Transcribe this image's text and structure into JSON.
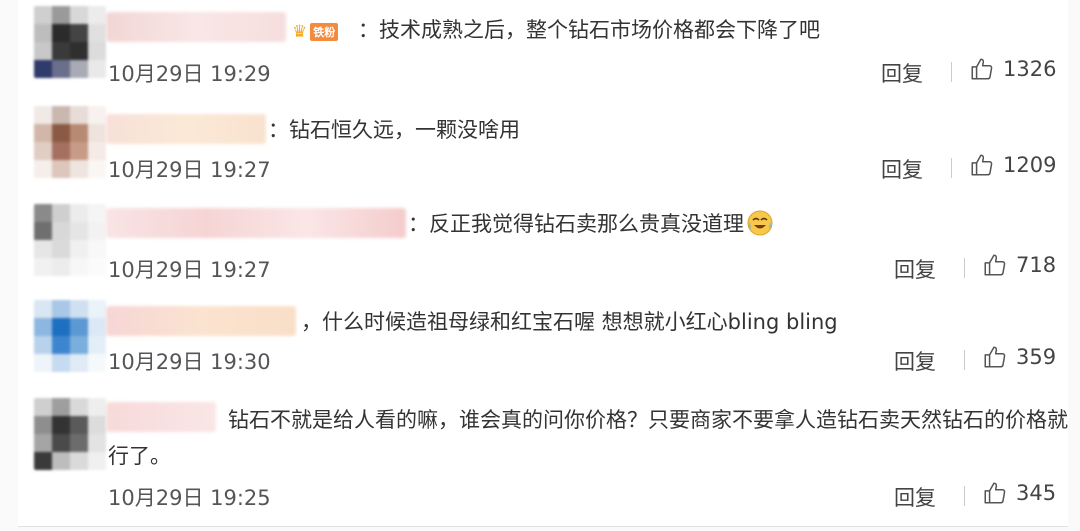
{
  "comments": [
    {
      "text": "：技术成熟之后，整个钻石市场价格都会下降了吧",
      "badge": {
        "tag": "铁粉"
      },
      "time": "10月29日 19:29",
      "reply_label": "回复",
      "likes": "1326"
    },
    {
      "text": "：钻石恒久远，一颗没啥用",
      "time": "10月29日 19:27",
      "reply_label": "回复",
      "likes": "1209"
    },
    {
      "text": "：反正我觉得钻石卖那么贵真没道理",
      "time": "10月29日 19:27",
      "reply_label": "回复",
      "likes": "718"
    },
    {
      "text": "，什么时候造祖母绿和红宝石喔 想想就小红心bling bling",
      "time": "10月29日 19:30",
      "reply_label": "回复",
      "likes": "359"
    },
    {
      "text": "钻石不就是给人看的嘛，谁会真的问你价格？只要商家不要拿人造钻石卖天然钻石的价格就行了。",
      "time": "10月29日 19:25",
      "reply_label": "回复",
      "likes": "345"
    }
  ],
  "icons": {
    "like": "thumbs-up-icon",
    "emoji": "crying-laughing-emoji",
    "crown": "crown-icon"
  },
  "colors": {
    "badge_tag": "#f38a3c",
    "crown": "#f6a623",
    "text": "#333333",
    "meta": "#555555"
  }
}
